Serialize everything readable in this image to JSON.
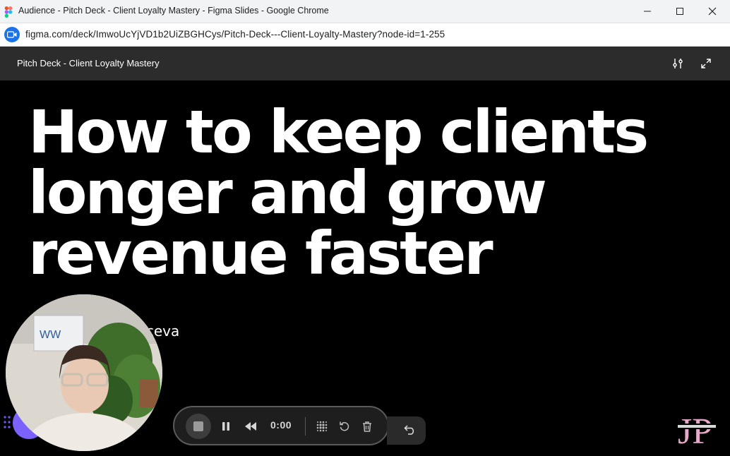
{
  "window": {
    "title": "Audience - Pitch Deck - Client Loyalty Mastery - Figma Slides - Google Chrome",
    "url": "figma.com/deck/ImwoUcYjVD1b2UiZBGHCys/Pitch-Deck---Client-Loyalty-Mastery?node-id=1-255"
  },
  "deck": {
    "title": "Pitch Deck - Client Loyalty Mastery"
  },
  "slide": {
    "headline_lines": [
      "How to keep clients",
      "longer and grow",
      "revenue faster"
    ],
    "presenter_partial": "yceva"
  },
  "recorder": {
    "time": "0:00"
  },
  "watermark": {
    "text": "JP"
  },
  "colors": {
    "accent_purple": "#7b61ff",
    "slide_bg": "#000000",
    "topbar_bg": "#2c2c2c"
  }
}
